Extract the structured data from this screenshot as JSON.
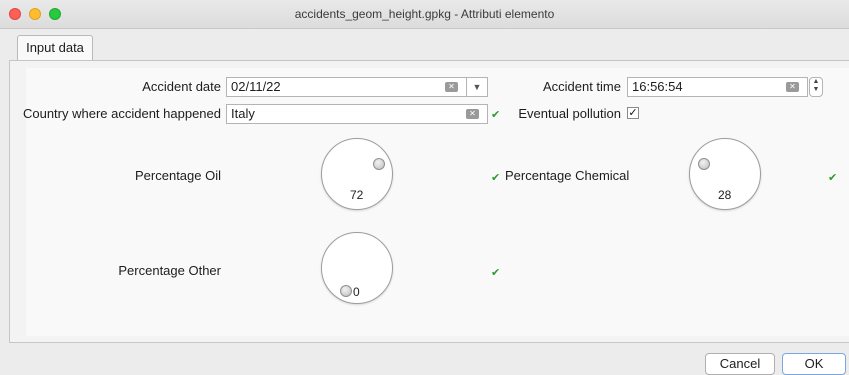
{
  "window": {
    "title": "accidents_geom_height.gpkg - Attributi elemento"
  },
  "tabs": [
    {
      "label": "Input data"
    }
  ],
  "form": {
    "accident_date": {
      "label": "Accident date",
      "value": "02/11/22"
    },
    "accident_time": {
      "label": "Accident time",
      "value": "16:56:54"
    },
    "country": {
      "label": "Country where accident happened",
      "value": "Italy"
    },
    "pollution": {
      "label": "Eventual pollution",
      "checked": true
    },
    "percentage_oil": {
      "label": "Percentage Oil",
      "value": "72"
    },
    "percentage_chemical": {
      "label": "Percentage Chemical",
      "value": "28"
    },
    "percentage_other": {
      "label": "Percentage Other",
      "value": "0"
    }
  },
  "buttons": {
    "cancel": "Cancel",
    "ok": "OK"
  },
  "icons": {
    "valid": "checkmark-icon",
    "clear": "clear-icon",
    "dropdown": "chevron-down-icon",
    "spinner": "up-down-arrows-icon"
  }
}
